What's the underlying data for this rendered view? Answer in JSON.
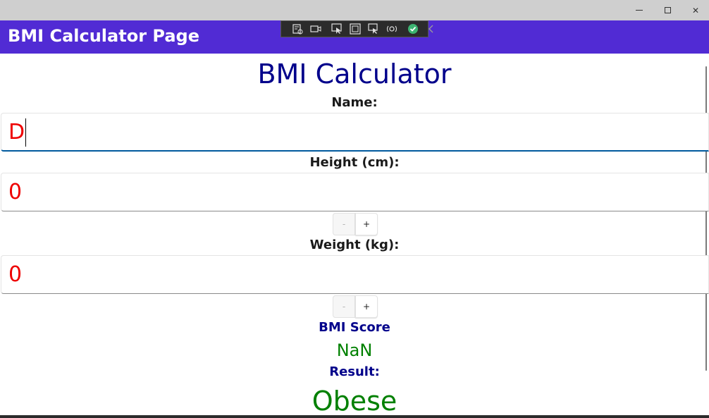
{
  "window": {
    "title": "",
    "minimize_glyph": "",
    "close_glyph": "✕"
  },
  "app_header": {
    "title": "BMI Calculator Page",
    "background": "#512bd4"
  },
  "page": {
    "heading": "BMI Calculator",
    "name_label": "Name:",
    "name_value": "D",
    "height_label": "Height (cm):",
    "height_value": "0",
    "weight_label": "Weight (kg):",
    "weight_value": "0",
    "stepper_minus": "-",
    "stepper_plus": "+",
    "score_label": "BMI Score",
    "score_value": "NaN",
    "result_label": "Result:",
    "result_value": "Obese"
  },
  "colors": {
    "heading": "#00008b",
    "entry_text": "#ee0000",
    "score_text": "#008000"
  },
  "debug_toolbar": {
    "icons": [
      "live-visual-tree-icon",
      "record-icon",
      "select-element-icon",
      "display-layout-adorners-icon",
      "track-focus-icon",
      "hot-reload-icon",
      "binding-check-icon",
      "collapse-chevron-icon"
    ]
  }
}
